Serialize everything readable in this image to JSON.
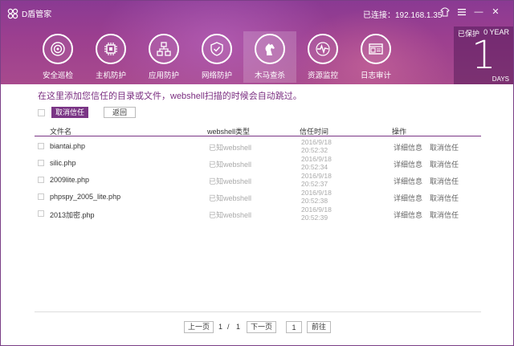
{
  "app": {
    "title": "D盾管家",
    "connection_label": "已连接：192.168.1.35",
    "window_controls": {
      "skin_icon": "shirt-icon",
      "menu_icon": "menu-icon",
      "minimize": "—",
      "close": "✕"
    }
  },
  "nav": {
    "items": [
      {
        "label": "安全巡检",
        "icon": "radar-icon"
      },
      {
        "label": "主机防护",
        "icon": "chip-icon"
      },
      {
        "label": "应用防护",
        "icon": "network-icon"
      },
      {
        "label": "网络防护",
        "icon": "shield-icon"
      },
      {
        "label": "木马查杀",
        "icon": "horse-icon",
        "active": true
      },
      {
        "label": "资源监控",
        "icon": "pulse-icon"
      },
      {
        "label": "日志审计",
        "icon": "log-icon"
      }
    ]
  },
  "protection": {
    "label": "已保护",
    "years": "0 YEAR",
    "days_value": "1",
    "days_label": "DAYS"
  },
  "main": {
    "hint": "在这里添加您信任的目录或文件，webshell扫描的时候会自动跳过。",
    "untrust_button": "取消信任",
    "back_button": "返回",
    "columns": [
      "文件名",
      "webshell类型",
      "信任时间",
      "操作"
    ],
    "rows": [
      {
        "name": "biantai.php",
        "type": "已知webshell",
        "date": "2016/9/18",
        "time": "20:52:32",
        "detail": "详细信息",
        "cancel": "取消信任"
      },
      {
        "name": "silic.php",
        "type": "已知webshell",
        "date": "2016/9/18",
        "time": "20:52:34",
        "detail": "详细信息",
        "cancel": "取消信任"
      },
      {
        "name": "2009lite.php",
        "type": "已知webshell",
        "date": "2016/9/18",
        "time": "20:52:37",
        "detail": "详细信息",
        "cancel": "取消信任"
      },
      {
        "name": "phpspy_2005_lite.php",
        "type": "已知webshell",
        "date": "2016/9/18",
        "time": "20:52:38",
        "detail": "详细信息",
        "cancel": "取消信任"
      },
      {
        "name": "2013加密.php",
        "type": "已知webshell",
        "date": "2016/9/18",
        "time": "20:52:39",
        "detail": "详细信息",
        "cancel": "取消信任"
      }
    ]
  },
  "pager": {
    "prev": "上一页",
    "current": "1",
    "separator": "/",
    "total": "1",
    "next": "下一页",
    "jump_value": "1",
    "go": "前往"
  },
  "colors": {
    "brand_purple": "#8a3a93",
    "accent_purple": "#7a3585"
  }
}
